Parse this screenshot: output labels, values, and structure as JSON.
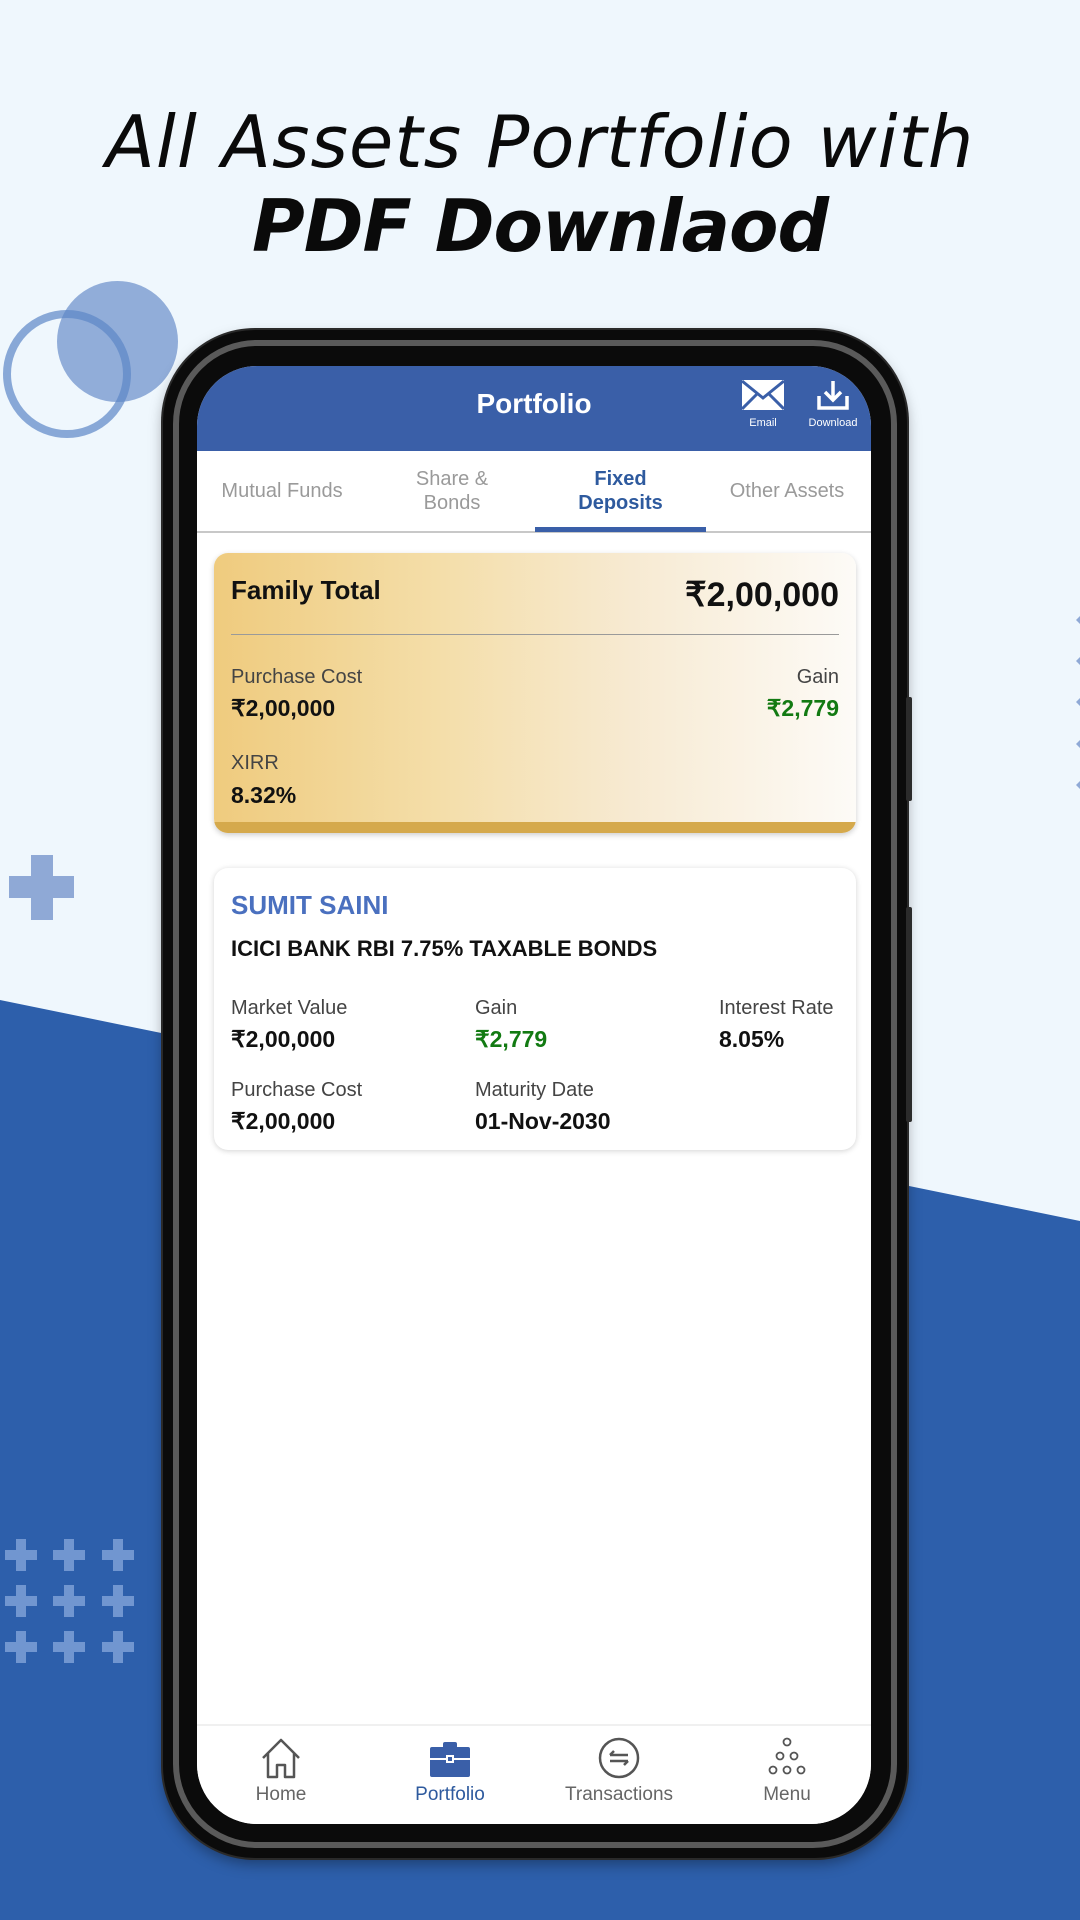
{
  "promo": {
    "headline_line1": "All Assets Portfolio with",
    "headline_line2": "PDF Downlaod"
  },
  "colors": {
    "primary": "#3a5fa8",
    "background_blue": "#2d5fab",
    "background_light": "#eff7fd",
    "gain_green": "#127a12",
    "gold": "#d5a94c"
  },
  "appbar": {
    "title": "Portfolio",
    "actions": [
      {
        "label": "Email",
        "icon": "envelope-icon"
      },
      {
        "label": "Download",
        "icon": "download-icon"
      }
    ]
  },
  "tabs": [
    {
      "label": "Mutual Funds",
      "active": false
    },
    {
      "label": "Share & Bonds",
      "active": false
    },
    {
      "label": "Fixed Deposits",
      "active": true
    },
    {
      "label": "Other Assets",
      "active": false
    }
  ],
  "family_total": {
    "title": "Family Total",
    "total_value": "₹2,00,000",
    "purchase_cost_label": "Purchase Cost",
    "purchase_cost_value": "₹2,00,000",
    "gain_label": "Gain",
    "gain_value": "₹2,779",
    "xirr_label": "XIRR",
    "xirr_value": "8.32%"
  },
  "holdings": [
    {
      "investor": "SUMIT SAINI",
      "scheme": "ICICI BANK RBI 7.75% TAXABLE BONDS",
      "market_value_label": "Market Value",
      "market_value": "₹2,00,000",
      "gain_label": "Gain",
      "gain": "₹2,779",
      "interest_rate_label": "Interest Rate",
      "interest_rate": "8.05%",
      "purchase_cost_label": "Purchase Cost",
      "purchase_cost": "₹2,00,000",
      "maturity_date_label": "Maturity Date",
      "maturity_date": "01-Nov-2030"
    }
  ],
  "bottom_nav": [
    {
      "label": "Home",
      "icon": "home-icon",
      "active": false
    },
    {
      "label": "Portfolio",
      "icon": "briefcase-icon",
      "active": true
    },
    {
      "label": "Transactions",
      "icon": "transfer-icon",
      "active": false
    },
    {
      "label": "Menu",
      "icon": "dots-menu-icon",
      "active": false
    }
  ]
}
